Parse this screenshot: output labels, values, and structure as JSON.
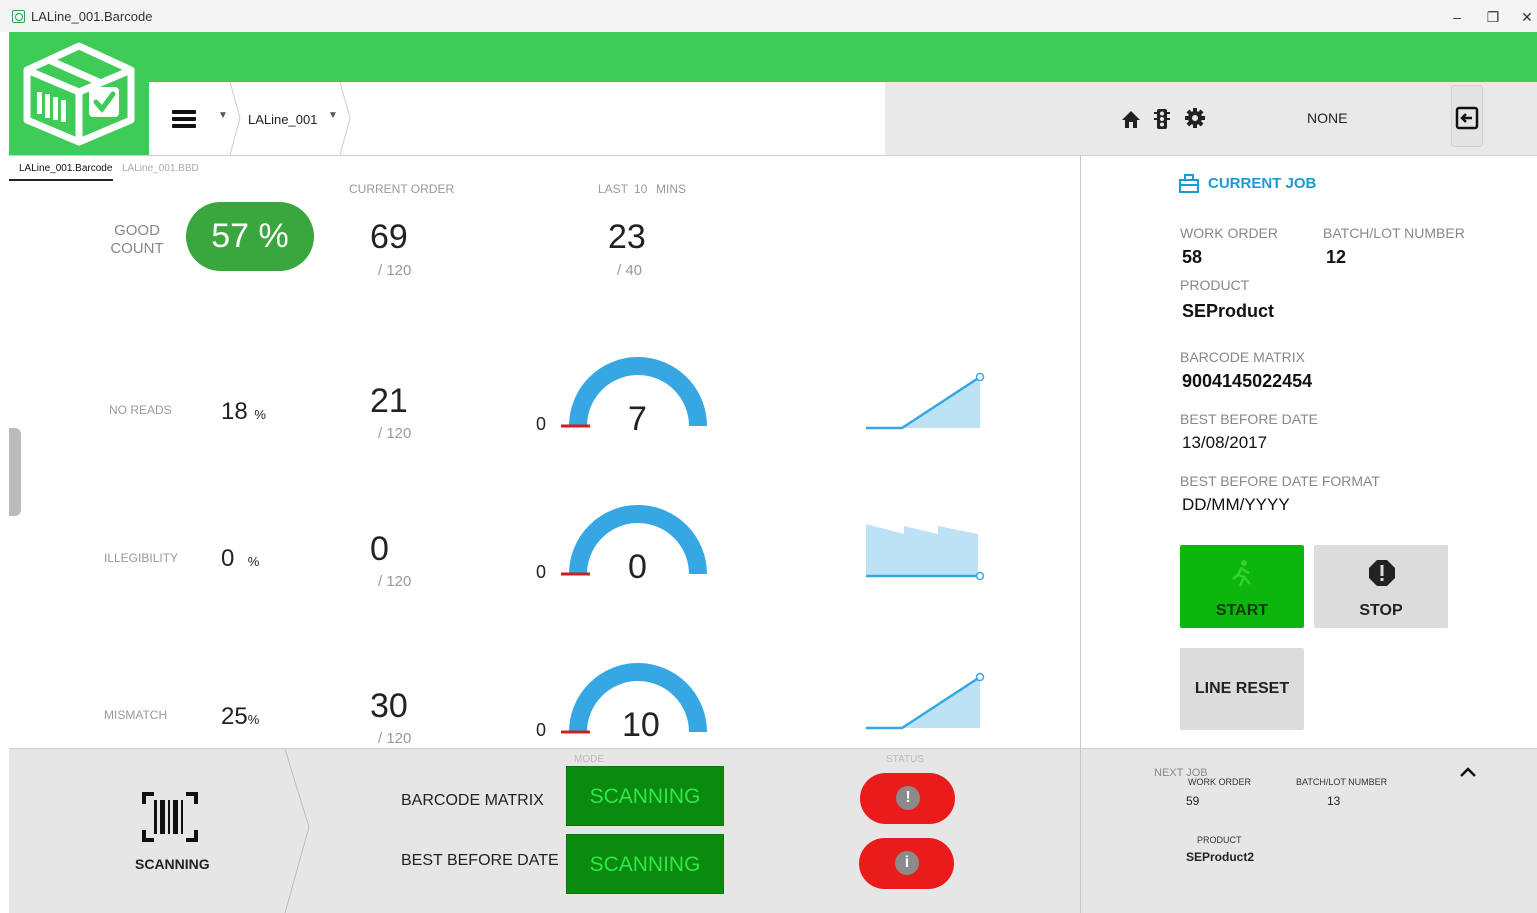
{
  "window": {
    "title": "LALine_001.Barcode",
    "minimize": "–",
    "restore": "❐",
    "close": "✕"
  },
  "header": {
    "menu_icon": "hamburger-icon",
    "breadcrumb_line": "LALine_001",
    "status_text": "NONE",
    "brand_color": "#3ecb58"
  },
  "tabs": [
    "LALine_001.Barcode",
    "LALine_001.BBD"
  ],
  "columns": {
    "current_order": "CURRENT ORDER",
    "last": "LAST",
    "last_value": "10",
    "mins": "MINS"
  },
  "good": {
    "label1": "GOOD",
    "label2": "COUNT",
    "percent": "57  %",
    "current": "69",
    "current_total": "/ 120",
    "last": "23",
    "last_total": "/ 40"
  },
  "rows": [
    {
      "label": "NO READS",
      "pct": "18",
      "pct_unit": "%",
      "count": "21",
      "total": "/ 120",
      "gauge_min": "0",
      "gauge_value": "7",
      "gauge_fraction": 1.0
    },
    {
      "label": "ILLEGIBILITY",
      "pct": "0",
      "pct_unit": "%",
      "count": "0",
      "total": "/ 120",
      "gauge_min": "0",
      "gauge_value": "0",
      "gauge_fraction": 1.0
    },
    {
      "label": "MISMATCH",
      "pct": "25",
      "pct_unit": "%",
      "count": "30",
      "total": "/ 120",
      "gauge_min": "0",
      "gauge_value": "10",
      "gauge_fraction": 1.0
    }
  ],
  "job": {
    "title": "CURRENT JOB",
    "work_order_label": "WORK ORDER",
    "work_order": "58",
    "batch_label": "BATCH/LOT NUMBER",
    "batch": "12",
    "product_label": "PRODUCT",
    "product": "SEProduct",
    "barcode_label": "BARCODE MATRIX",
    "barcode": "9004145022454",
    "bbd_label": "BEST BEFORE DATE",
    "bbd": "13/08/2017",
    "bbd_format_label": "BEST BEFORE DATE FORMAT",
    "bbd_format": "DD/MM/YYYY",
    "start": "START",
    "stop": "STOP",
    "line_reset": "LINE RESET"
  },
  "bottom": {
    "scanner_label": "SCANNING",
    "mode_label": "MODE",
    "status_label": "STATUS",
    "items": [
      {
        "label": "BARCODE MATRIX",
        "mode": "SCANNING"
      },
      {
        "label": "BEST BEFORE DATE",
        "mode": "SCANNING"
      }
    ]
  },
  "next_job": {
    "title": "NEXT JOB",
    "work_order_label": "WORK ORDER",
    "work_order": "59",
    "batch_label": "BATCH/LOT NUMBER",
    "batch": "13",
    "product_label": "PRODUCT",
    "product": "SEProduct2"
  }
}
